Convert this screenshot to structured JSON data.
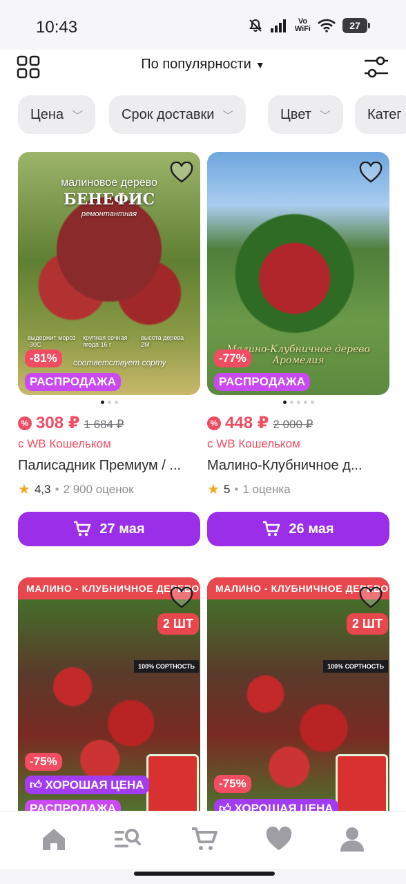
{
  "status_bar": {
    "time": "10:43",
    "network_label_top": "Vo",
    "network_label_bottom": "WiFi",
    "battery": "27"
  },
  "top_bar": {
    "sort_label": "По популярности",
    "icons": [
      "grid-icon",
      "filters-icon"
    ]
  },
  "filter_chips": [
    {
      "label": "Цена"
    },
    {
      "label": "Срок доставки"
    },
    {
      "label": "Цвет"
    },
    {
      "label": "Катег"
    }
  ],
  "products": [
    {
      "image_title": "малиновое дерево",
      "image_subtitle": "БЕНЕФИС",
      "image_note": "ремонтантная",
      "image_caption": "соответствует сорту",
      "image_features": [
        "выдержит мороз -30С",
        "крупная сочная ягода 16 г",
        "высота дерева 2М"
      ],
      "discount": "-81%",
      "badge": "РАСПРОДАЖА",
      "price": "308 ₽",
      "old_price": "1 684 ₽",
      "wallet_note": "с WB Кошельком",
      "title": "Палисадник Премиум / ...",
      "rating": "4,3",
      "reviews": "2 900 оценок",
      "delivery": "27 мая"
    },
    {
      "image_caption": "Малино-Клубничное дерево Аромелия",
      "discount": "-77%",
      "badge": "РАСПРОДАЖА",
      "price": "448 ₽",
      "old_price": "2 000 ₽",
      "wallet_note": "с WB Кошельком",
      "title": "Малино-Клубничное д...",
      "rating": "5",
      "reviews": "1 оценка",
      "delivery": "26 мая"
    },
    {
      "ribbon": "МАЛИНО - КЛУБНИЧНОЕ ДЕРЕВО",
      "qty": "2 ШТ",
      "tag": "100% СОРТНОСТЬ",
      "discount": "-75%",
      "badge_good": "ХОРОШАЯ ЦЕНА",
      "badge": "РАСПРОДАЖА"
    },
    {
      "ribbon": "МАЛИНО - КЛУБНИЧНОЕ ДЕРЕВО",
      "qty": "2 ШТ",
      "tag": "100% СОРТНОСТЬ",
      "discount": "-75%",
      "badge_good": "ХОРОШАЯ ЦЕНА"
    }
  ],
  "bottom_nav": [
    "home-icon",
    "catalog-search-icon",
    "cart-icon",
    "favorites-icon",
    "profile-icon"
  ],
  "colors": {
    "accent": "#9b2ee8",
    "price": "#f04d63",
    "sale": "#c94af0"
  }
}
